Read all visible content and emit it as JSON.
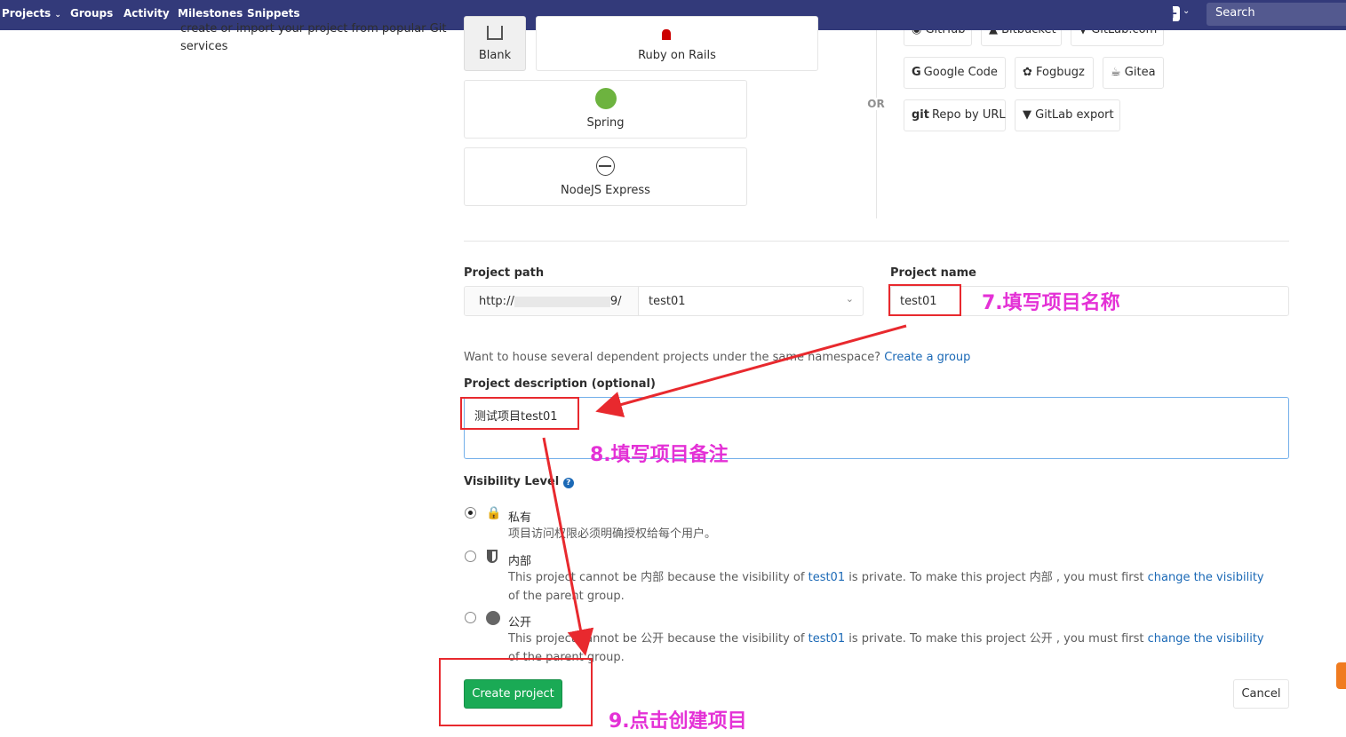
{
  "nav": {
    "projects": "Projects",
    "groups": "Groups",
    "activity": "Activity",
    "milestones": "Milestones",
    "snippets": "Snippets",
    "search_placeholder": "Search",
    "bar_color": "#333a7a"
  },
  "left_help": {
    "line1": "create or import your project from popular Git",
    "line2": "services"
  },
  "templates": {
    "blank": "Blank",
    "rails": "Ruby on Rails",
    "spring": "Spring",
    "nodejs": "NodeJS Express"
  },
  "or_label": "OR",
  "imports": {
    "github": "GitHub",
    "bitbucket": "Bitbucket",
    "gitlab_com": "GitLab.com",
    "google_code": "Google Code",
    "fogbugz": "Fogbugz",
    "gitea": "Gitea",
    "repo_by_url_prefix": "git",
    "repo_by_url": "Repo by URL",
    "gitlab_export": "GitLab export"
  },
  "form": {
    "path_label": "Project path",
    "path_prefix_start": "http://",
    "path_prefix_end": "9/",
    "namespace": "test01",
    "name_label": "Project name",
    "name_value": "test01",
    "group_hint": "Want to house several dependent projects under the same namespace?",
    "create_group": "Create a group",
    "desc_label": "Project description (optional)",
    "desc_value": "测试项目test01",
    "visibility_label": "Visibility Level",
    "private_title": "私有",
    "private_desc": "项目访问权限必须明确授权给每个用户。",
    "internal_title": "内部",
    "internal_desc_a": "This project cannot be 内部 because the visibility of",
    "internal_desc_link": "test01",
    "internal_desc_b": "is private. To make this project 内部 , you must first",
    "internal_desc_link2": "change the visibility",
    "internal_desc_c": "of the",
    "internal_desc_d": "parent group.",
    "public_title": "公开",
    "public_desc_a": "This project cannot be 公开 because the visibility of",
    "public_desc_link": "test01",
    "public_desc_b": "is private. To make this project 公开 , you must first",
    "public_desc_link2": "change the visibility",
    "public_desc_c": "of the",
    "public_desc_d": "parent group.",
    "create_button": "Create project",
    "cancel_button": "Cancel"
  },
  "annotations": {
    "step7": "7.填写项目名称",
    "step8": "8.填写项目备注",
    "step9": "9.点击创建项目",
    "box_color": "#e8292e",
    "text_color": "#e431d6"
  }
}
